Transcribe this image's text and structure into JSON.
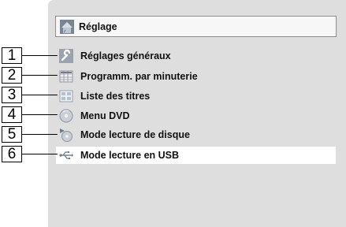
{
  "header": {
    "title": "Réglage",
    "icon": "settings-icon"
  },
  "menu": {
    "items": [
      {
        "number": "1",
        "label": "Réglages généraux",
        "icon": "wrench-icon",
        "selected": false
      },
      {
        "number": "2",
        "label": "Programm. par minuterie",
        "icon": "timer-grid-icon",
        "selected": false
      },
      {
        "number": "3",
        "label": "Liste des titres",
        "icon": "title-list-icon",
        "selected": false
      },
      {
        "number": "4",
        "label": "Menu DVD",
        "icon": "disc-icon",
        "selected": false
      },
      {
        "number": "5",
        "label": "Mode lecture de disque",
        "icon": "disc-play-icon",
        "selected": false
      },
      {
        "number": "6",
        "label": "Mode lecture en USB",
        "icon": "usb-icon",
        "selected": true
      }
    ]
  },
  "colors": {
    "panel": "#dedede",
    "selected_row": "#ffffff"
  }
}
